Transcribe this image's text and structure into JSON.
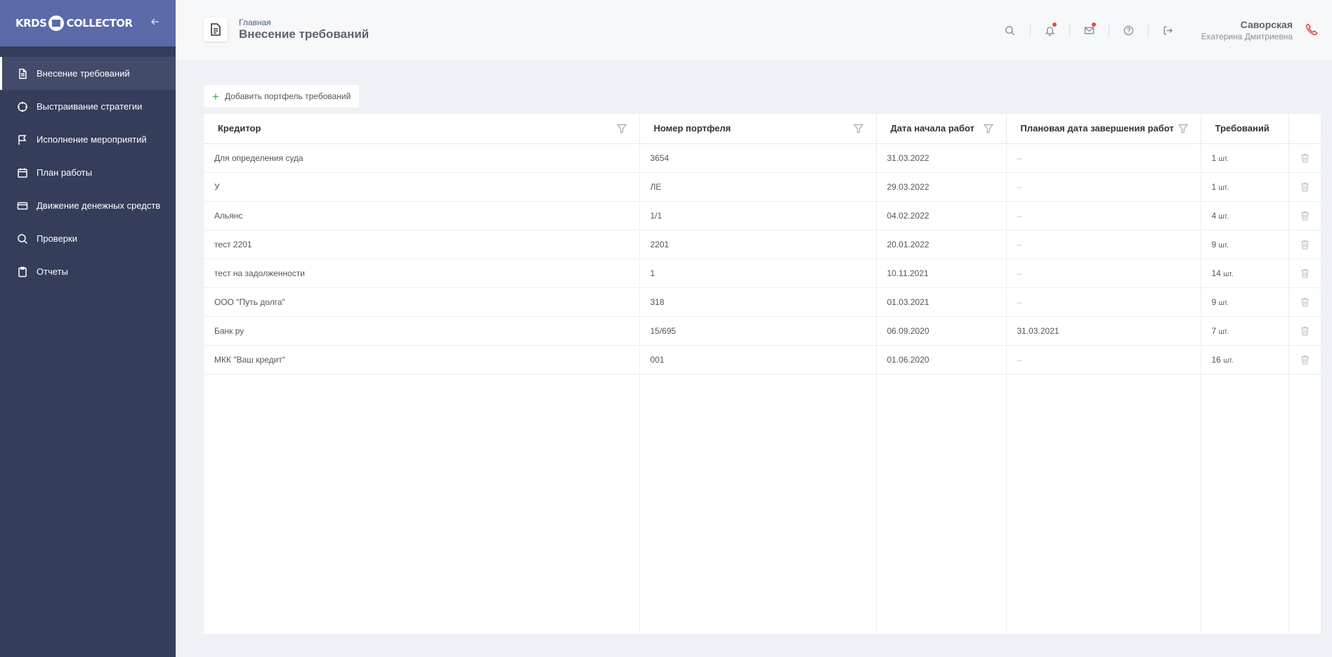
{
  "sidebar": {
    "logo_left": "KRDS",
    "logo_right": "COLLECTOR",
    "collapse_icon": "arrow-left-icon",
    "items": [
      {
        "label": "Внесение требований",
        "icon": "document-icon",
        "active": true
      },
      {
        "label": "Выстраивание стратегии",
        "icon": "target-icon",
        "active": false
      },
      {
        "label": "Исполнение мероприятий",
        "icon": "flag-icon",
        "active": false
      },
      {
        "label": "План работы",
        "icon": "calendar-icon",
        "active": false
      },
      {
        "label": "Движение денежных средств",
        "icon": "credit-card-icon",
        "active": false
      },
      {
        "label": "Проверки",
        "icon": "search-icon",
        "active": false
      },
      {
        "label": "Отчеты",
        "icon": "clipboard-icon",
        "active": false
      }
    ]
  },
  "header": {
    "breadcrumb": "Главная",
    "title": "Внесение требований",
    "tools": [
      "search-icon",
      "bell-icon",
      "mail-icon",
      "help-icon",
      "logout-icon"
    ],
    "user": {
      "last_name": "Саворская",
      "first_names": "Екатерина Дмитриевна"
    },
    "phone_icon": "phone-icon"
  },
  "toolbar": {
    "add_label": "Добавить портфель требований"
  },
  "table": {
    "columns": [
      "Кредитор",
      "Номер портфеля",
      "Дата начала работ",
      "Плановая дата завершения работ",
      "Требований"
    ],
    "unit": "шт.",
    "rows": [
      {
        "creditor": "Для определения суда",
        "portfolio": "3654",
        "start": "31.03.2022",
        "end": "–",
        "count": "1"
      },
      {
        "creditor": "У",
        "portfolio": "ЛЕ",
        "start": "29.03.2022",
        "end": "–",
        "count": "1"
      },
      {
        "creditor": "Альянс",
        "portfolio": "1/1",
        "start": "04.02.2022",
        "end": "–",
        "count": "4"
      },
      {
        "creditor": "тест 2201",
        "portfolio": "2201",
        "start": "20.01.2022",
        "end": "–",
        "count": "9"
      },
      {
        "creditor": "тест на задолженности",
        "portfolio": "1",
        "start": "10.11.2021",
        "end": "–",
        "count": "14"
      },
      {
        "creditor": "ООО \"Путь долга\"",
        "portfolio": "318",
        "start": "01.03.2021",
        "end": "–",
        "count": "9"
      },
      {
        "creditor": "Банк ру",
        "portfolio": "15/695",
        "start": "06.09.2020",
        "end": "31.03.2021",
        "count": "7"
      },
      {
        "creditor": "МКК \"Ваш кредит\"",
        "portfolio": "001",
        "start": "01.06.2020",
        "end": "–",
        "count": "16"
      }
    ]
  },
  "colors": {
    "sidebar_bg": "#343d5a",
    "sidebar_top": "#5b6aa8",
    "accent_red": "#e24b4b",
    "add_green": "#3aa54a"
  }
}
